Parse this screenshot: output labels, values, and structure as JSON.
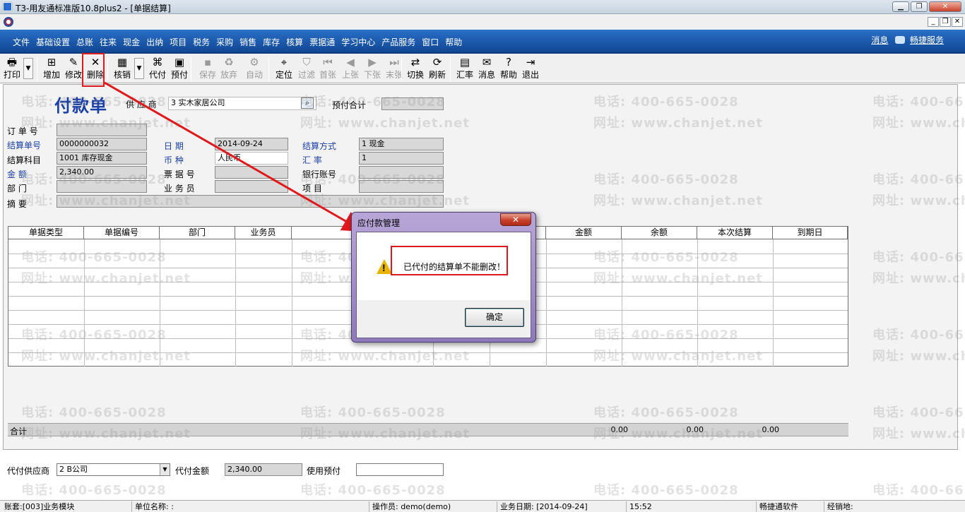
{
  "window": {
    "title": "T3-用友通标准版10.8plus2 - [单据结算]",
    "min": "▁",
    "max": "❐",
    "close": "✕",
    "mdi_min": "_",
    "mdi_restore": "❐",
    "mdi_close": "✕"
  },
  "menu": [
    "文件",
    "基础设置",
    "总账",
    "往来",
    "现金",
    "出纳",
    "项目",
    "税务",
    "采购",
    "销售",
    "库存",
    "核算",
    "票据通",
    "学习中心",
    "产品服务",
    "窗口",
    "帮助"
  ],
  "header_links": {
    "messages": "消息",
    "service": "畅捷服务"
  },
  "toolbar": [
    {
      "label": "打印",
      "icon": "printer-icon",
      "glyph": "🖶",
      "enabled": true
    },
    {
      "label": "增加",
      "icon": "add-doc-icon",
      "glyph": "⊞",
      "enabled": true
    },
    {
      "label": "修改",
      "icon": "edit-icon",
      "glyph": "✎",
      "enabled": true
    },
    {
      "label": "删除",
      "icon": "delete-icon",
      "glyph": "✕",
      "enabled": true
    },
    {
      "label": "核销",
      "icon": "writeoff-icon",
      "glyph": "▦",
      "enabled": true
    },
    {
      "label": "代付",
      "icon": "proxy-pay-icon",
      "glyph": "⌘",
      "enabled": true
    },
    {
      "label": "预付",
      "icon": "prepay-icon",
      "glyph": "▣",
      "enabled": true
    },
    {
      "label": "保存",
      "icon": "save-icon",
      "glyph": "▪",
      "enabled": false
    },
    {
      "label": "放弃",
      "icon": "discard-icon",
      "glyph": "♻",
      "enabled": false
    },
    {
      "label": "自动",
      "icon": "auto-icon",
      "glyph": "⚙",
      "enabled": false
    },
    {
      "label": "定位",
      "icon": "locate-icon",
      "glyph": "⌖",
      "enabled": true
    },
    {
      "label": "过滤",
      "icon": "filter-icon",
      "glyph": "⛉",
      "enabled": false
    },
    {
      "label": "首张",
      "icon": "first-icon",
      "glyph": "⏮",
      "enabled": false
    },
    {
      "label": "上张",
      "icon": "prev-icon",
      "glyph": "◀",
      "enabled": false
    },
    {
      "label": "下张",
      "icon": "next-icon",
      "glyph": "▶",
      "enabled": false
    },
    {
      "label": "末张",
      "icon": "last-icon",
      "glyph": "⏭",
      "enabled": false
    },
    {
      "label": "切换",
      "icon": "switch-icon",
      "glyph": "⇄",
      "enabled": true
    },
    {
      "label": "刷新",
      "icon": "refresh-icon",
      "glyph": "⟳",
      "enabled": true
    },
    {
      "label": "汇率",
      "icon": "rate-icon",
      "glyph": "▤",
      "enabled": true
    },
    {
      "label": "消息",
      "icon": "message-icon",
      "glyph": "✉",
      "enabled": true
    },
    {
      "label": "帮助",
      "icon": "help-icon",
      "glyph": "?",
      "enabled": true
    },
    {
      "label": "退出",
      "icon": "exit-icon",
      "glyph": "⇥",
      "enabled": true
    }
  ],
  "form": {
    "title": "付款单",
    "supplier_label": "供 应 商",
    "supplier_value": "3  实木家居公司",
    "prepay_total_label": "预付合计",
    "prepay_total_value": "",
    "order_no_label": "订 单 号",
    "order_no_value": "",
    "settle_no_label": "结算单号",
    "settle_no_value": "0000000032",
    "date_label": "日    期",
    "date_value": "2014-09-24",
    "settle_method_label": "结算方式",
    "settle_method_value": "1  现金",
    "account_label": "结算科目",
    "account_value": "1001  库存现金",
    "currency_label": "币    种",
    "currency_value": "人民币",
    "rate_label": "汇    率",
    "rate_value": "1",
    "amount_label": "金    额",
    "amount_value": "2,340.00",
    "bill_no_label": "票 据 号",
    "bill_no_value": "",
    "bank_account_label": "银行账号",
    "bank_account_value": "",
    "dept_label": "部    门",
    "dept_value": "",
    "salesman_label": "业 务 员",
    "salesman_value": "",
    "project_label": "项    目",
    "project_value": "",
    "memo_label": "摘    要",
    "memo_value": ""
  },
  "grid": {
    "columns": [
      "单据类型",
      "单据编号",
      "部门",
      "业务员",
      "",
      "",
      "",
      "金额",
      "余额",
      "本次结算",
      "到期日"
    ],
    "sum_label": "合计",
    "sum_amount": "0.00",
    "sum_balance": "0.00",
    "sum_this": "0.00"
  },
  "footer": {
    "proxy_supplier_label": "代付供应商",
    "proxy_supplier_value": "2  B公司",
    "proxy_amount_label": "代付金额",
    "proxy_amount_value": "2,340.00",
    "use_prepay_label": "使用预付",
    "use_prepay_value": ""
  },
  "dialog": {
    "title": "应付款管理",
    "message": "已代付的结算单不能删改！",
    "ok": "确定",
    "close": "✕"
  },
  "status": {
    "account": "账套:[003]业务模块",
    "company": "单位名称: :",
    "operator": "操作员: demo(demo)",
    "biz_date": "业务日期: [2014-09-24]",
    "time": "15:52",
    "brand": "畅捷通软件",
    "dealer": "经销地:"
  },
  "watermark": {
    "phone": "电话: 400-665-0028",
    "site": "网址: www.chanjet.net"
  },
  "colors": {
    "menubar_blue": "#1a56a8",
    "form_title": "#1b3fa8",
    "highlight": "#e0191c",
    "dialog_frame": "#8d7ab8"
  }
}
